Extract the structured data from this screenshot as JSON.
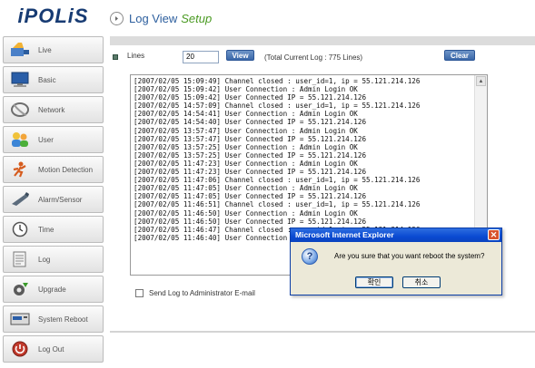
{
  "sidebar": {
    "logo": "iPOLiS",
    "items": [
      {
        "label": "Live",
        "icon": "live-camera-icon"
      },
      {
        "label": "Basic",
        "icon": "monitor-icon"
      },
      {
        "label": "Network",
        "icon": "network-icon"
      },
      {
        "label": "User",
        "icon": "users-icon"
      },
      {
        "label": "Motion Detection",
        "icon": "motion-detection-icon"
      },
      {
        "label": "Alarm/Sensor",
        "icon": "alarm-sensor-icon"
      },
      {
        "label": "Time",
        "icon": "clock-icon"
      },
      {
        "label": "Log",
        "icon": "log-icon"
      },
      {
        "label": "Upgrade",
        "icon": "upgrade-icon"
      },
      {
        "label": "System Reboot",
        "icon": "system-reboot-icon"
      },
      {
        "label": "Log Out",
        "icon": "log-out-icon"
      }
    ]
  },
  "header": {
    "title": "Log View",
    "subtitle": "Setup"
  },
  "controls": {
    "lines_label": "Lines",
    "lines_value": "20",
    "view_label": "View",
    "total_text": "(Total Current Log : 775 Lines)",
    "clear_label": "Clear"
  },
  "log": {
    "lines": [
      "[2007/02/05 15:09:49] Channel closed : user_id=1, ip = 55.121.214.126",
      "[2007/02/05 15:09:42] User Connection : Admin Login OK",
      "[2007/02/05 15:09:42] User Connected IP = 55.121.214.126",
      "[2007/02/05 14:57:09] Channel closed : user_id=1, ip = 55.121.214.126",
      "[2007/02/05 14:54:41] User Connection : Admin Login OK",
      "[2007/02/05 14:54:40] User Connected IP = 55.121.214.126",
      "[2007/02/05 13:57:47] User Connection : Admin Login OK",
      "[2007/02/05 13:57:47] User Connected IP = 55.121.214.126",
      "[2007/02/05 13:57:25] User Connection : Admin Login OK",
      "[2007/02/05 13:57:25] User Connected IP = 55.121.214.126",
      "[2007/02/05 11:47:23] User Connection : Admin Login OK",
      "[2007/02/05 11:47:23] User Connected IP = 55.121.214.126",
      "[2007/02/05 11:47:06] Channel closed : user_id=1, ip = 55.121.214.126",
      "[2007/02/05 11:47:05] User Connection : Admin Login OK",
      "[2007/02/05 11:47:05] User Connected IP = 55.121.214.126",
      "[2007/02/05 11:46:51] Channel closed : user_id=1, ip = 55.121.214.126",
      "[2007/02/05 11:46:50] User Connection : Admin Login OK",
      "[2007/02/05 11:46:50] User Connected IP = 55.121.214.126",
      "[2007/02/05 11:46:47] Channel closed : user_id=1, ip = 55.121.214.126",
      "[2007/02/05 11:46:40] User Connection : Admin Login OK"
    ]
  },
  "email": {
    "label": "Send Log to Administrator E-mail"
  },
  "dialog": {
    "title": "Microsoft Internet Explorer",
    "icon": "question-icon",
    "message": "Are you sure that you want reboot the system?",
    "ok_label": "확인",
    "cancel_label": "취소",
    "close_glyph": "✕"
  }
}
